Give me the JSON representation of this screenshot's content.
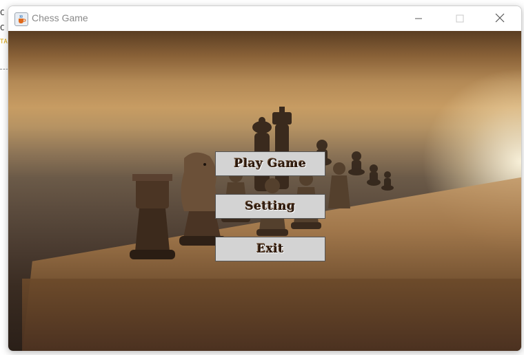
{
  "window": {
    "title": "Chess Game"
  },
  "menu": {
    "play_label": "Play Game",
    "setting_label": "Setting",
    "exit_label": "Exit"
  },
  "background_fragments": {
    "line1": "C",
    "line2": "C",
    "line3": "TA"
  },
  "icons": {
    "app": "java-coffee-icon",
    "minimize": "minimize-icon",
    "maximize": "maximize-icon",
    "close": "close-icon"
  },
  "colors": {
    "button_bg": "#d3d3d3",
    "button_text": "#2c1a0f",
    "title_text": "#8a8a8a"
  }
}
